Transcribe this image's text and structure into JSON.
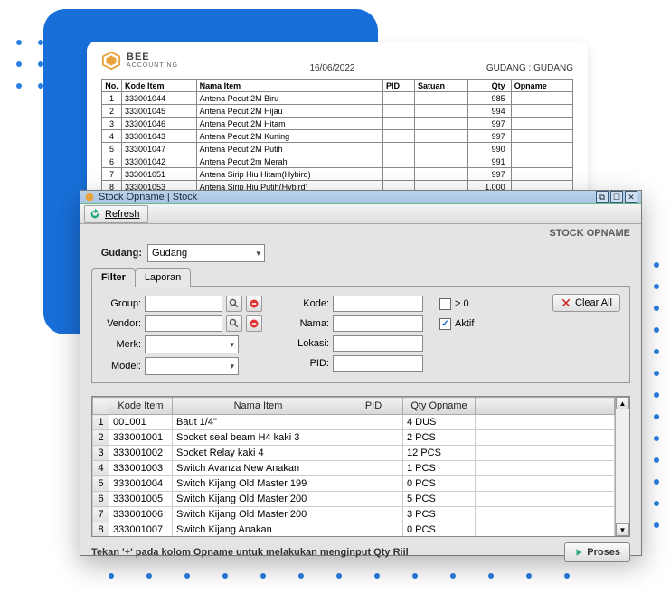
{
  "decor": {},
  "report": {
    "logo_brand": "BEE",
    "logo_sub": "ACCOUNTING",
    "date": "16/06/2022",
    "gudang_label": "GUDANG : GUDANG",
    "columns": [
      "No.",
      "Kode Item",
      "Nama Item",
      "PID",
      "Satuan",
      "Qty",
      "Opname"
    ],
    "rows": [
      {
        "no": "1",
        "kode": "333001044",
        "nama": "Antena Pecut 2M Biru",
        "pid": "",
        "satuan": "",
        "qty": "985",
        "opname": ""
      },
      {
        "no": "2",
        "kode": "333001045",
        "nama": "Antena Pecut 2M Hijau",
        "pid": "",
        "satuan": "",
        "qty": "994",
        "opname": ""
      },
      {
        "no": "3",
        "kode": "333001046",
        "nama": "Antena Pecut 2M Hitam",
        "pid": "",
        "satuan": "",
        "qty": "997",
        "opname": ""
      },
      {
        "no": "4",
        "kode": "333001043",
        "nama": "Antena Pecut 2M Kuning",
        "pid": "",
        "satuan": "",
        "qty": "997",
        "opname": ""
      },
      {
        "no": "5",
        "kode": "333001047",
        "nama": "Antena Pecut 2M Putih",
        "pid": "",
        "satuan": "",
        "qty": "990",
        "opname": ""
      },
      {
        "no": "6",
        "kode": "333001042",
        "nama": "Antena Pecut 2m Merah",
        "pid": "",
        "satuan": "",
        "qty": "991",
        "opname": ""
      },
      {
        "no": "7",
        "kode": "333001051",
        "nama": "Antena Sirip Hiu Hitam(Hybird)",
        "pid": "",
        "satuan": "",
        "qty": "997",
        "opname": ""
      },
      {
        "no": "8",
        "kode": "333001053",
        "nama": "Antena Sirip Hiu Putih(Hybird)",
        "pid": "",
        "satuan": "",
        "qty": "1,000",
        "opname": ""
      }
    ]
  },
  "window": {
    "title": "Stock Opname | Stock",
    "refresh_label": "Refresh",
    "section_label": "STOCK OPNAME",
    "gudang_label": "Gudang:",
    "gudang_value": "Gudang",
    "tabs": {
      "filter": "Filter",
      "laporan": "Laporan"
    },
    "filter": {
      "group_label": "Group:",
      "vendor_label": "Vendor:",
      "merk_label": "Merk:",
      "model_label": "Model:",
      "kode_label": "Kode:",
      "nama_label": "Nama:",
      "lokasi_label": "Lokasi:",
      "pid_label": "PID:",
      "gt0_label": "> 0",
      "aktif_label": "Aktif",
      "clear_all_label": "Clear All"
    },
    "grid": {
      "columns": [
        "Kode Item",
        "Nama Item",
        "PID",
        "Qty Opname"
      ],
      "rows": [
        {
          "n": "1",
          "kode": "001001",
          "nama": "Baut 1/4\"",
          "pid": "",
          "qty": "4 DUS"
        },
        {
          "n": "2",
          "kode": "333001001",
          "nama": "Socket seal beam H4 kaki 3",
          "pid": "",
          "qty": "2 PCS"
        },
        {
          "n": "3",
          "kode": "333001002",
          "nama": "Socket Relay kaki 4",
          "pid": "",
          "qty": "12 PCS"
        },
        {
          "n": "4",
          "kode": "333001003",
          "nama": "Switch Avanza New Anakan",
          "pid": "",
          "qty": "1 PCS"
        },
        {
          "n": "5",
          "kode": "333001004",
          "nama": "Switch Kijang Old Master 199",
          "pid": "",
          "qty": "0 PCS"
        },
        {
          "n": "6",
          "kode": "333001005",
          "nama": "Switch Kijang Old Master 200",
          "pid": "",
          "qty": "5 PCS"
        },
        {
          "n": "7",
          "kode": "333001006",
          "nama": "Switch Kijang Old Master 200",
          "pid": "",
          "qty": "3 PCS"
        },
        {
          "n": "8",
          "kode": "333001007",
          "nama": "Switch Kijang Anakan",
          "pid": "",
          "qty": "0 PCS"
        }
      ]
    },
    "footer_hint": "Tekan '+' pada kolom Opname untuk melakukan menginput Qty Riil",
    "proses_label": "Proses"
  }
}
